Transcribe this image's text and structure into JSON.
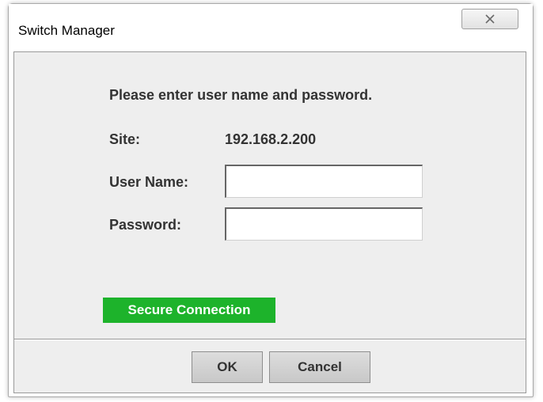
{
  "window": {
    "title": "Switch Manager",
    "close_icon": "close-x-icon"
  },
  "dialog": {
    "prompt": "Please enter user name and password.",
    "site_label": "Site:",
    "site_value": "192.168.2.200",
    "username_label": "User Name:",
    "username_value": "",
    "password_label": "Password:",
    "password_value": "",
    "secure_badge": "Secure Connection",
    "secure_color": "#1db32b"
  },
  "buttons": {
    "ok_label": "OK",
    "cancel_label": "Cancel"
  }
}
